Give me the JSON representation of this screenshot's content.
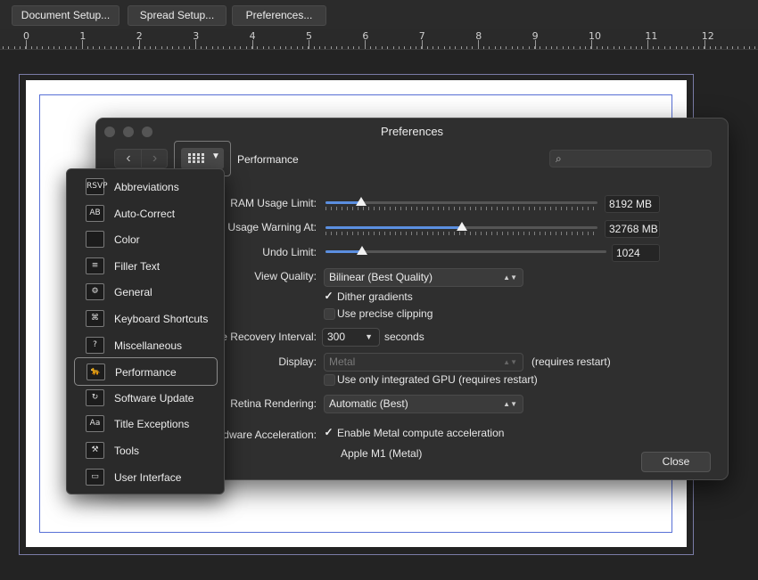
{
  "toolbar": {
    "buttons": [
      "Document Setup...",
      "Spread Setup...",
      "Preferences..."
    ]
  },
  "ruler": {
    "labels": [
      "0",
      "1",
      "2",
      "3",
      "4",
      "5",
      "6",
      "7",
      "8",
      "9",
      "10",
      "11",
      "12"
    ]
  },
  "preferences": {
    "title": "Preferences",
    "section": "Performance",
    "search_placeholder": "",
    "nav": {
      "back": "‹",
      "forward": "›"
    },
    "rows": {
      "ram": {
        "label": "RAM Usage Limit:",
        "value": "8192 MB",
        "fill_fraction": 0.13
      },
      "disk": {
        "label": "k Usage Warning At:",
        "value": "32768 MB",
        "fill_fraction": 0.5
      },
      "undo": {
        "label": "Undo Limit:",
        "value": "1024",
        "fill_fraction": 0.13
      },
      "view_quality": {
        "label": "View Quality:",
        "value": "Bilinear (Best Quality)"
      },
      "dither": {
        "label": "Dither gradients",
        "checked": true
      },
      "precise": {
        "label": "Use precise clipping",
        "checked": false
      },
      "recovery": {
        "label": "e Recovery Interval:",
        "value": "300",
        "unit": "seconds"
      },
      "display": {
        "label": "Display:",
        "value": "Metal",
        "note": "(requires restart)"
      },
      "integrated_gpu": {
        "label": "Use only integrated GPU (requires restart)",
        "checked": false
      },
      "retina": {
        "label": "Retina Rendering:",
        "value": "Automatic (Best)"
      },
      "hw_accel": {
        "label": "dware Acceleration:",
        "checkbox_label": "Enable Metal compute acceleration",
        "checked": true,
        "device": "Apple M1 (Metal)"
      }
    },
    "close_label": "Close",
    "checkmark": "✓"
  },
  "menu": {
    "items": [
      {
        "label": "Abbreviations",
        "icon": "abbreviations-icon",
        "glyph": "RSVP"
      },
      {
        "label": "Auto-Correct",
        "icon": "auto-correct-icon",
        "glyph": "AB"
      },
      {
        "label": "Color",
        "icon": "color-icon",
        "glyph": ""
      },
      {
        "label": "Filler Text",
        "icon": "filler-text-icon",
        "glyph": "≡"
      },
      {
        "label": "General",
        "icon": "general-icon",
        "glyph": "⚙"
      },
      {
        "label": "Keyboard Shortcuts",
        "icon": "keyboard-shortcuts-icon",
        "glyph": "⌘"
      },
      {
        "label": "Miscellaneous",
        "icon": "miscellaneous-icon",
        "glyph": "?"
      },
      {
        "label": "Performance",
        "icon": "performance-icon",
        "glyph": "🐆",
        "selected": true
      },
      {
        "label": "Software Update",
        "icon": "software-update-icon",
        "glyph": "↻"
      },
      {
        "label": "Title Exceptions",
        "icon": "title-exceptions-icon",
        "glyph": "Aa"
      },
      {
        "label": "Tools",
        "icon": "tools-icon",
        "glyph": "⚒"
      },
      {
        "label": "User Interface",
        "icon": "user-interface-icon",
        "glyph": "▭"
      }
    ]
  },
  "colors": {
    "accent": "#5b8fe0",
    "margin_guide": "#5870d6",
    "spread_border": "#7a7ca6"
  }
}
